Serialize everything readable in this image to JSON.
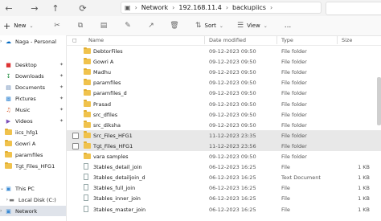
{
  "addressbar": {
    "back_icon": "back-arrow-icon",
    "forward_icon": "forward-arrow-icon",
    "up_icon": "up-arrow-icon",
    "refresh_icon": "refresh-icon",
    "path": [
      "Network",
      "192.168.11.4",
      "backupiics"
    ]
  },
  "toolbar": {
    "new_label": "New",
    "sort_label": "Sort",
    "view_label": "View",
    "more_label": "..."
  },
  "sidebar": {
    "items": [
      {
        "label": "Naga - Personal",
        "icon": "cloud-icon",
        "pinned": false
      },
      {
        "label": "Desktop",
        "icon": "desktop-icon",
        "pinned": true
      },
      {
        "label": "Downloads",
        "icon": "download-icon",
        "pinned": true
      },
      {
        "label": "Documents",
        "icon": "documents-icon",
        "pinned": true
      },
      {
        "label": "Pictures",
        "icon": "pictures-icon",
        "pinned": true
      },
      {
        "label": "Music",
        "icon": "music-icon",
        "pinned": true
      },
      {
        "label": "Videos",
        "icon": "videos-icon",
        "pinned": true
      },
      {
        "label": "iics_hfg1",
        "icon": "folder-icon",
        "pinned": false
      },
      {
        "label": "Gowri A",
        "icon": "folder-icon",
        "pinned": false
      },
      {
        "label": "paramfiles",
        "icon": "folder-icon",
        "pinned": false
      },
      {
        "label": "Tgt_Files_HFG1",
        "icon": "folder-icon",
        "pinned": false
      },
      {
        "label": "This PC",
        "icon": "pc-icon",
        "pinned": false
      },
      {
        "label": "Local Disk (C:)",
        "icon": "drive-icon",
        "pinned": false
      },
      {
        "label": "Network",
        "icon": "network-icon",
        "pinned": false,
        "selected": true
      }
    ]
  },
  "columns": {
    "name": "Name",
    "date": "Date modified",
    "type": "Type",
    "size": "Size"
  },
  "rows": [
    {
      "name": "DebtorFiles",
      "date": "09-12-2023 09:50",
      "type": "File folder",
      "size": "",
      "kind": "folder"
    },
    {
      "name": "Gowri A",
      "date": "09-12-2023 09:50",
      "type": "File folder",
      "size": "",
      "kind": "folder"
    },
    {
      "name": "Madhu",
      "date": "09-12-2023 09:50",
      "type": "File folder",
      "size": "",
      "kind": "folder"
    },
    {
      "name": "paramfiles",
      "date": "09-12-2023 09:50",
      "type": "File folder",
      "size": "",
      "kind": "folder"
    },
    {
      "name": "paramfiles_d",
      "date": "09-12-2023 09:50",
      "type": "File folder",
      "size": "",
      "kind": "folder"
    },
    {
      "name": "Prasad",
      "date": "09-12-2023 09:50",
      "type": "File folder",
      "size": "",
      "kind": "folder"
    },
    {
      "name": "src_dfiles",
      "date": "09-12-2023 09:50",
      "type": "File folder",
      "size": "",
      "kind": "folder"
    },
    {
      "name": "src_diksha",
      "date": "09-12-2023 09:50",
      "type": "File folder",
      "size": "",
      "kind": "folder"
    },
    {
      "name": "Src_Files_HFG1",
      "date": "11-12-2023 23:35",
      "type": "File folder",
      "size": "",
      "kind": "folder",
      "selected": true
    },
    {
      "name": "Tgt_Files_HFG1",
      "date": "11-12-2023 23:56",
      "type": "File folder",
      "size": "",
      "kind": "folder",
      "selected": true
    },
    {
      "name": "vara samples",
      "date": "09-12-2023 09:50",
      "type": "File folder",
      "size": "",
      "kind": "folder"
    },
    {
      "name": "3tables_detail_join",
      "date": "06-12-2023 16:25",
      "type": "File",
      "size": "1 KB",
      "kind": "file"
    },
    {
      "name": "3tables_detailjoin_d",
      "date": "06-12-2023 16:25",
      "type": "Text Document",
      "size": "1 KB",
      "kind": "file"
    },
    {
      "name": "3tables_full_join",
      "date": "06-12-2023 16:25",
      "type": "File",
      "size": "1 KB",
      "kind": "file"
    },
    {
      "name": "3tables_inner_join",
      "date": "06-12-2023 16:25",
      "type": "File",
      "size": "1 KB",
      "kind": "file"
    },
    {
      "name": "3tables_master_join",
      "date": "06-12-2023 16:25",
      "type": "File",
      "size": "1 KB",
      "kind": "file"
    }
  ],
  "colors": {
    "folder": "#f0c24c",
    "selected_row": "#e8e8e8",
    "nav_selected": "#dfe3ea",
    "accent": "#0067c0"
  }
}
